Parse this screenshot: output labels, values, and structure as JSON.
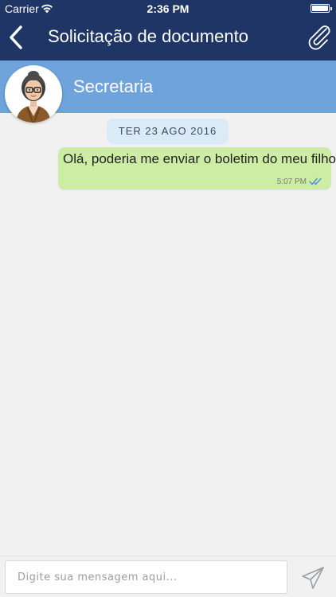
{
  "status_bar": {
    "carrier": "Carrier",
    "time": "2:36 PM"
  },
  "nav": {
    "title": "Solicitação de documento",
    "back_icon": "chevron-left-icon",
    "attach_icon": "paperclip-icon"
  },
  "contact": {
    "name": "Secretaria",
    "avatar": "avatar-woman-glasses"
  },
  "chat": {
    "date_label": "TER 23 AGO 2016",
    "messages": [
      {
        "text": "Olá, poderia me enviar o boletim do meu filho?",
        "time": "5:07 PM",
        "status": "read"
      }
    ]
  },
  "composer": {
    "placeholder": "Digite sua mensagem aqui...",
    "value": "",
    "send_icon": "paper-plane-icon"
  },
  "colors": {
    "nav_bg": "#1f3566",
    "contact_bg": "#6ea3dc",
    "bubble_bg": "#cdeda4",
    "date_chip_bg": "#dbeaf7",
    "chat_bg": "#f1f1f1",
    "read_ticks": "#4a90d9"
  }
}
